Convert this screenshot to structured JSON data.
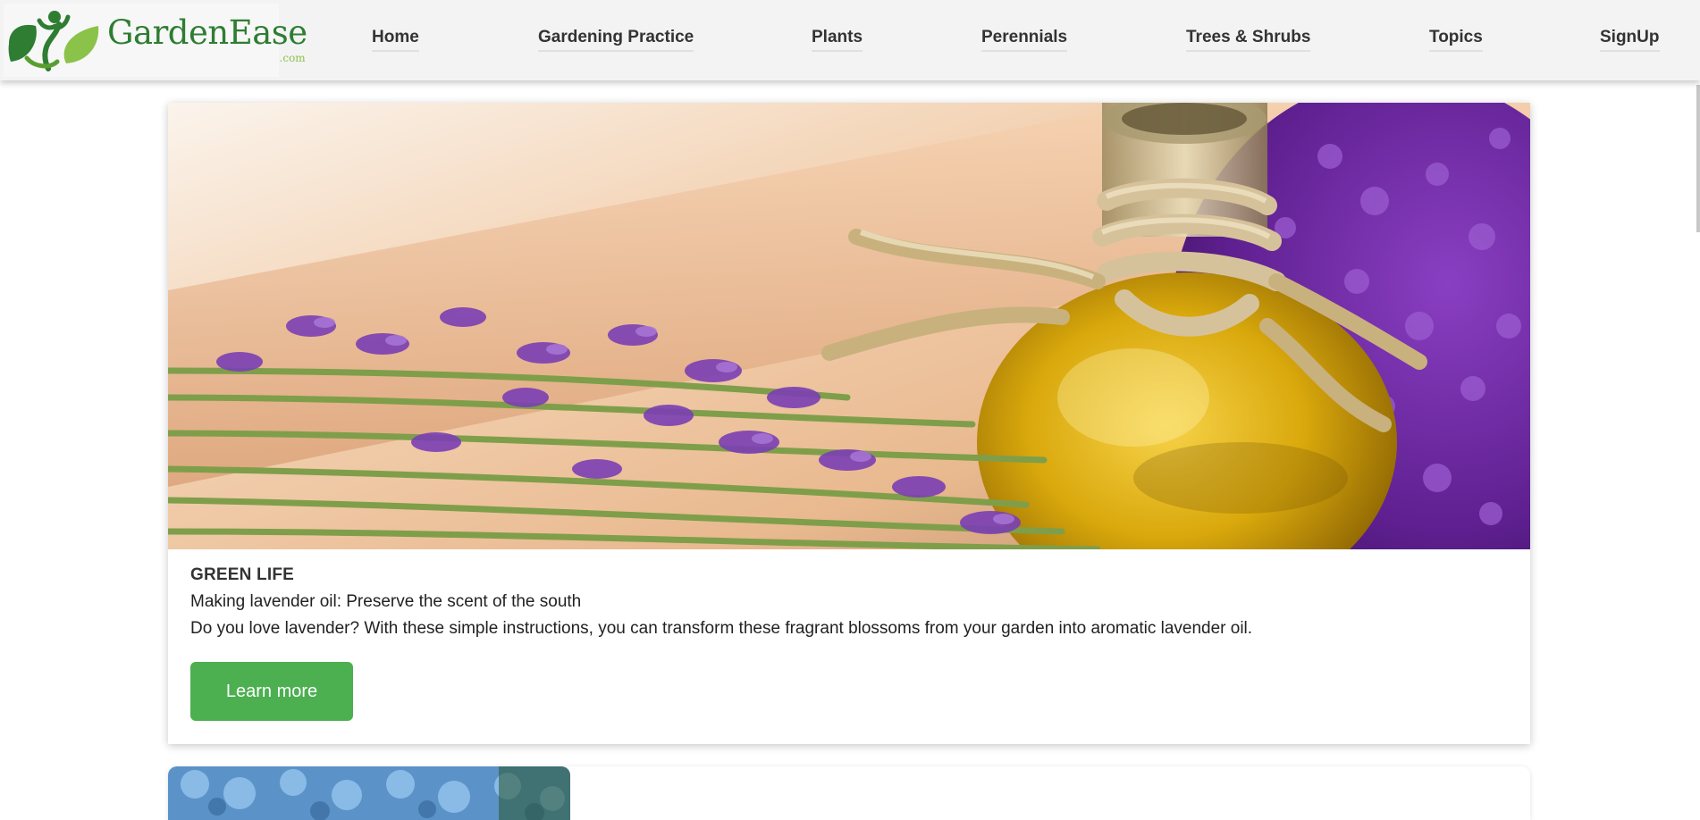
{
  "brand": {
    "name": "GardenEase",
    "tld": ".com"
  },
  "nav": {
    "items": [
      {
        "label": "Home"
      },
      {
        "label": "Gardening Practice"
      },
      {
        "label": "Plants"
      },
      {
        "label": "Perennials"
      },
      {
        "label": "Trees & Shrubs"
      },
      {
        "label": "Topics"
      },
      {
        "label": "SignUp"
      }
    ]
  },
  "featured": {
    "category": "GREEN LIFE",
    "title": "Making lavender oil: Preserve the scent of the south",
    "description": "Do you love lavender? With these simple instructions, you can transform these fragrant blossoms from your garden into aromatic lavender oil.",
    "button_label": "Learn more",
    "image_subject": "lavender-oil-bottle-photo"
  },
  "next_card": {
    "image_subject": "blue-hydrangea-photo"
  },
  "colors": {
    "header_bg": "#f3f3f3",
    "brand_green": "#2e7d32",
    "brand_light_green": "#8bc34a",
    "button_green": "#4caf50",
    "text": "#222222"
  }
}
